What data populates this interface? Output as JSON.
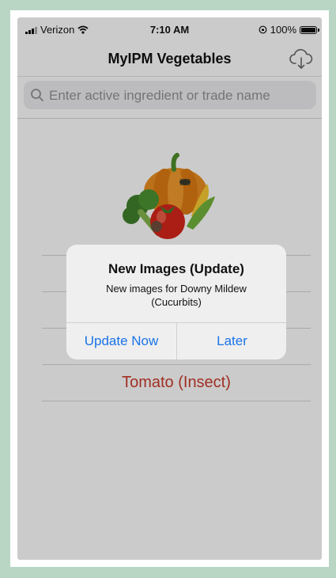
{
  "status_bar": {
    "carrier": "Verizon",
    "time": "7:10 AM",
    "battery": "100%"
  },
  "navbar": {
    "title": "MyIPM Vegetables",
    "action_icon": "cloud-download-icon"
  },
  "search": {
    "placeholder": "Enter active ingredient or trade name",
    "value": ""
  },
  "list": {
    "items": [
      {
        "label": ""
      },
      {
        "label": ""
      },
      {
        "label": ""
      },
      {
        "label": "Tomato (Insect)"
      }
    ]
  },
  "alert": {
    "title": "New Images (Update)",
    "message": "New images for Downy Mildew (Cucurbits)",
    "primary_button": "Update Now",
    "secondary_button": "Later"
  },
  "colors": {
    "background_green": "#b9d6c5",
    "list_text": "#c43a2b",
    "alert_button": "#1a73e8"
  }
}
